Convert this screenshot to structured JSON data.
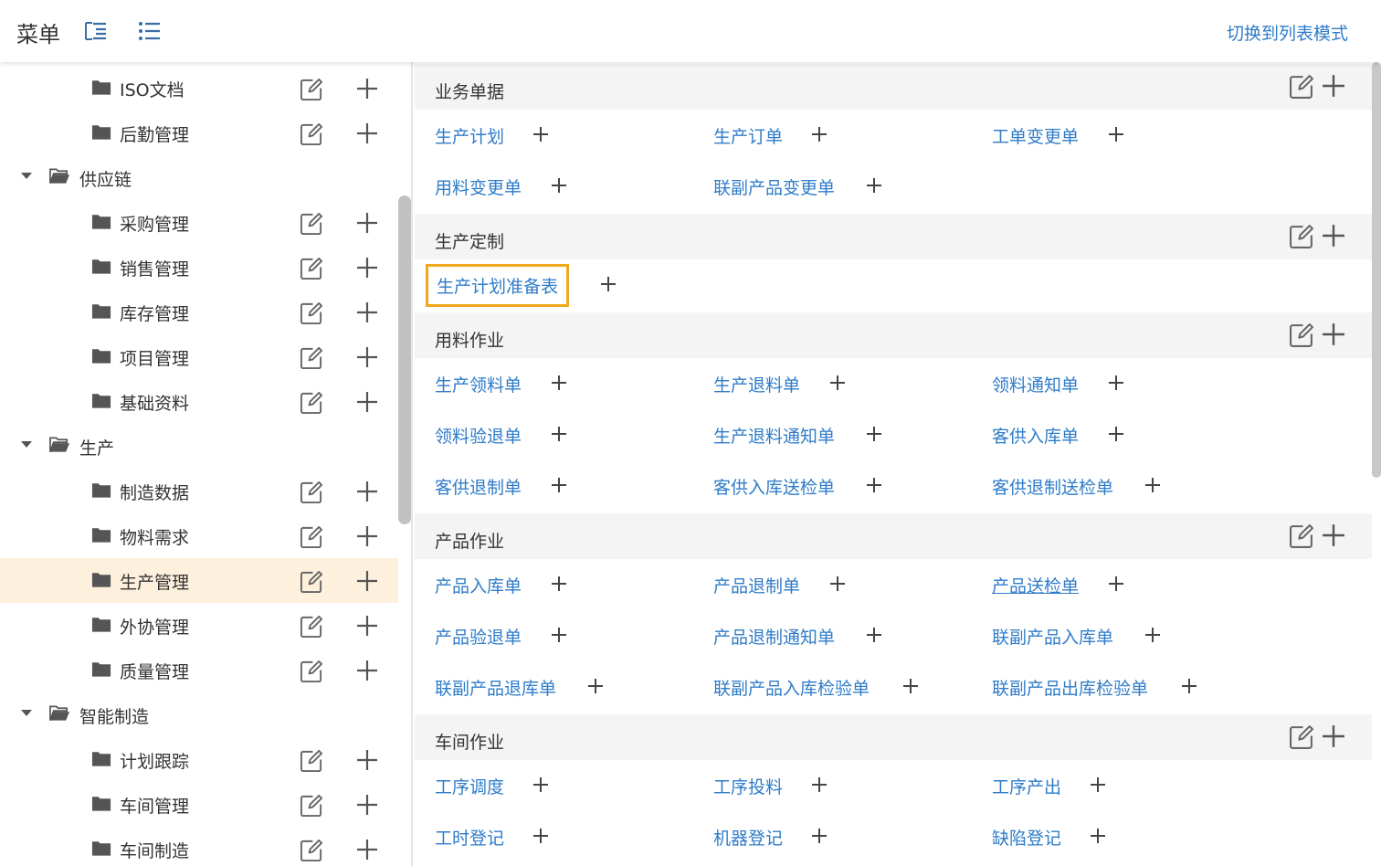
{
  "header": {
    "title": "菜单",
    "switch_label": "切换到列表模式"
  },
  "sidebar": {
    "items": [
      {
        "label": "ISO文档",
        "level": 2
      },
      {
        "label": "后勤管理",
        "level": 2
      },
      {
        "label": "供应链",
        "level": 1,
        "expanded": true
      },
      {
        "label": "采购管理",
        "level": 2
      },
      {
        "label": "销售管理",
        "level": 2
      },
      {
        "label": "库存管理",
        "level": 2
      },
      {
        "label": "项目管理",
        "level": 2
      },
      {
        "label": "基础资料",
        "level": 2
      },
      {
        "label": "生产",
        "level": 1,
        "expanded": true
      },
      {
        "label": "制造数据",
        "level": 2
      },
      {
        "label": "物料需求",
        "level": 2
      },
      {
        "label": "生产管理",
        "level": 2,
        "selected": true
      },
      {
        "label": "外协管理",
        "level": 2
      },
      {
        "label": "质量管理",
        "level": 2
      },
      {
        "label": "智能制造",
        "level": 1,
        "expanded": true
      },
      {
        "label": "计划跟踪",
        "level": 2
      },
      {
        "label": "车间管理",
        "level": 2
      },
      {
        "label": "车间制造",
        "level": 2
      }
    ]
  },
  "sections": [
    {
      "title": "业务单据",
      "items": [
        {
          "label": "生产计划"
        },
        {
          "label": "生产订单"
        },
        {
          "label": "工单变更单"
        },
        {
          "label": "用料变更单"
        },
        {
          "label": "联副产品变更单"
        }
      ]
    },
    {
      "title": "生产定制",
      "items": [
        {
          "label": "生产计划准备表",
          "focused": true
        }
      ]
    },
    {
      "title": "用料作业",
      "items": [
        {
          "label": "生产领料单"
        },
        {
          "label": "生产退料单"
        },
        {
          "label": "领料通知单"
        },
        {
          "label": "领料验退单"
        },
        {
          "label": "生产退料通知单"
        },
        {
          "label": "客供入库单"
        },
        {
          "label": "客供退制单"
        },
        {
          "label": "客供入库送检单"
        },
        {
          "label": "客供退制送检单"
        }
      ]
    },
    {
      "title": "产品作业",
      "items": [
        {
          "label": "产品入库单"
        },
        {
          "label": "产品退制单"
        },
        {
          "label": "产品送检单",
          "underline": true
        },
        {
          "label": "产品验退单"
        },
        {
          "label": "产品退制通知单"
        },
        {
          "label": "联副产品入库单"
        },
        {
          "label": "联副产品退库单"
        },
        {
          "label": "联副产品入库检验单"
        },
        {
          "label": "联副产品出库检验单"
        }
      ]
    },
    {
      "title": "车间作业",
      "items": [
        {
          "label": "工序调度"
        },
        {
          "label": "工序投料"
        },
        {
          "label": "工序产出"
        },
        {
          "label": "工时登记"
        },
        {
          "label": "机器登记"
        },
        {
          "label": "缺陷登记"
        }
      ]
    }
  ],
  "colors": {
    "link": "#2f7cc9",
    "selected_bg": "#fdf0dc",
    "focus_outline": "#f0a81c",
    "section_bg": "#f4f4f4"
  }
}
